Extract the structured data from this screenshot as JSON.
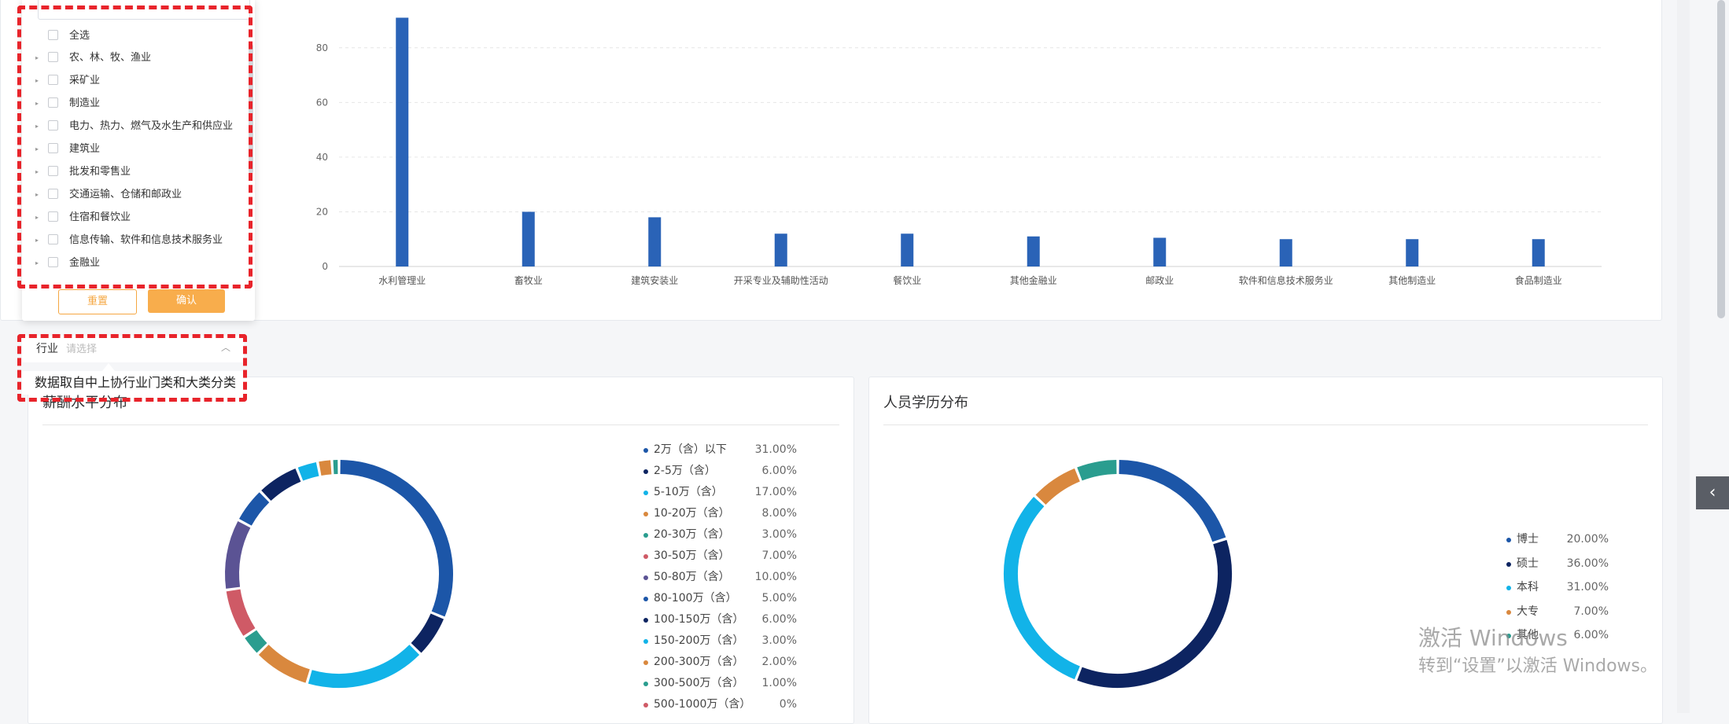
{
  "chart_data": [
    {
      "type": "bar",
      "categories": [
        "水利管理业",
        "畜牧业",
        "建筑安装业",
        "开采专业及辅助性活动",
        "餐饮业",
        "其他金融业",
        "邮政业",
        "软件和信息技术服务业",
        "其他制造业",
        "食品制造业"
      ],
      "values": [
        91,
        20,
        18,
        12,
        12,
        11,
        10.5,
        10,
        10,
        10
      ],
      "ylim": [
        0,
        90
      ],
      "yticks": [
        0,
        20,
        40,
        60,
        80
      ],
      "grid": true,
      "bar_color": "#2a63b7"
    },
    {
      "type": "pie",
      "title": "薪酬水平分布",
      "donut": true,
      "labels": [
        "2万（含）以下",
        "2-5万（含）",
        "5-10万（含）",
        "10-20万（含）",
        "20-30万（含）",
        "30-50万（含）",
        "50-80万（含）",
        "80-100万（含）",
        "100-150万（含）",
        "150-200万（含）",
        "200-300万（含）",
        "300-500万（含）",
        "500-1000万（含）"
      ],
      "values": [
        31,
        6,
        17,
        8,
        3,
        7,
        10,
        5,
        6,
        3,
        2,
        1,
        0
      ],
      "value_labels": [
        "31.00%",
        "6.00%",
        "17.00%",
        "8.00%",
        "3.00%",
        "7.00%",
        "10.00%",
        "5.00%",
        "6.00%",
        "3.00%",
        "2.00%",
        "1.00%",
        "0%"
      ],
      "colors": [
        "#1c56a8",
        "#0d2461",
        "#12b3e8",
        "#d9883e",
        "#2a9d8f",
        "#cf5a66",
        "#5b5394",
        "#1c56a8",
        "#0d2461",
        "#12b3e8",
        "#d9883e",
        "#2a9d8f",
        "#cf5a66"
      ]
    },
    {
      "type": "pie",
      "title": "人员学历分布",
      "donut": true,
      "labels": [
        "博士",
        "硕士",
        "本科",
        "大专",
        "其他"
      ],
      "values": [
        20,
        36,
        31,
        7,
        6
      ],
      "value_labels": [
        "20.00%",
        "36.00%",
        "31.00%",
        "7.00%",
        "6.00%"
      ],
      "colors": [
        "#1c56a8",
        "#0d2461",
        "#12b3e8",
        "#d9883e",
        "#2a9d8f"
      ]
    }
  ],
  "dropdown": {
    "select_all": "全选",
    "items": [
      "农、林、牧、渔业",
      "采矿业",
      "制造业",
      "电力、热力、燃气及水生产和供应业",
      "建筑业",
      "批发和零售业",
      "交通运输、仓储和邮政业",
      "住宿和餐饮业",
      "信息传输、软件和信息技术服务业",
      "金融业"
    ],
    "reset_label": "重置",
    "confirm_label": "确认"
  },
  "filter": {
    "label": "行业",
    "placeholder": "请选择",
    "tooltip": "数据取自中上协行业门类和大类分类"
  },
  "icons": {
    "caret": "▸",
    "chevron_up": "︿",
    "side_toggle": "‹"
  },
  "watermark": {
    "line1": "激活 Windows",
    "line2": "转到“设置”以激活 Windows。"
  },
  "accent_color": "#f8ad4c",
  "highlight_color": "#e8242b"
}
